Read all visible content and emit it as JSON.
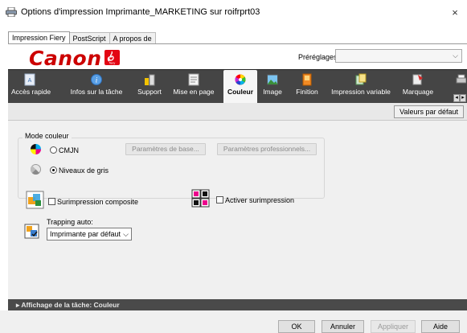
{
  "window": {
    "title": "Options d'impression Imprimante_MARKETING sur roifrprt03",
    "close_glyph": "×"
  },
  "tabs": [
    {
      "label": "Impression Fiery",
      "active": true
    },
    {
      "label": "PostScript",
      "active": false
    },
    {
      "label": "A propos de",
      "active": false
    }
  ],
  "brand": {
    "logo_text": "Canon",
    "fiery_badge": "fiery"
  },
  "presets": {
    "label": "Préréglages:",
    "value": ""
  },
  "toolbar": {
    "items": [
      {
        "label": "Accès rapide",
        "icon": "quick-access-icon",
        "active": false
      },
      {
        "label": "Infos sur la tâche",
        "icon": "info-icon",
        "active": false
      },
      {
        "label": "Support",
        "icon": "media-icon",
        "active": false
      },
      {
        "label": "Mise en page",
        "icon": "layout-icon",
        "active": false
      },
      {
        "label": "Couleur",
        "icon": "color-wheel-icon",
        "active": true
      },
      {
        "label": "Image",
        "icon": "image-icon",
        "active": false
      },
      {
        "label": "Finition",
        "icon": "finishing-icon",
        "active": false
      },
      {
        "label": "Impression variable",
        "icon": "variable-print-icon",
        "active": false
      },
      {
        "label": "Marquage",
        "icon": "stamping-icon",
        "active": false
      }
    ],
    "scroll_left": "◂",
    "scroll_right": "▸"
  },
  "defaults_button": "Valeurs par défaut",
  "color_mode": {
    "legend": "Mode couleur",
    "cmjn_label": "CMJN",
    "cmjn_selected": false,
    "gray_label": "Niveaux de gris",
    "gray_selected": true,
    "basic_params_button": "Paramètres de base...",
    "pro_params_button": "Paramètres professionnels..."
  },
  "composite_overprint": {
    "label": "Surimpression composite",
    "checked": false
  },
  "enable_overprint": {
    "label": "Activer surimpression",
    "checked": false
  },
  "trapping": {
    "label": "Trapping auto:",
    "value": "Imprimante par défaut"
  },
  "job_bar": {
    "arrow": "▸",
    "label": "Affichage de la tâche: Couleur"
  },
  "footer": {
    "ok": "OK",
    "cancel": "Annuler",
    "apply": "Appliquer",
    "help": "Aide"
  },
  "colors": {
    "toolbar_bg": "#454545",
    "canon_red": "#cc0000",
    "fiery_red": "#e30613",
    "panel_bg": "#f0f0f0"
  }
}
